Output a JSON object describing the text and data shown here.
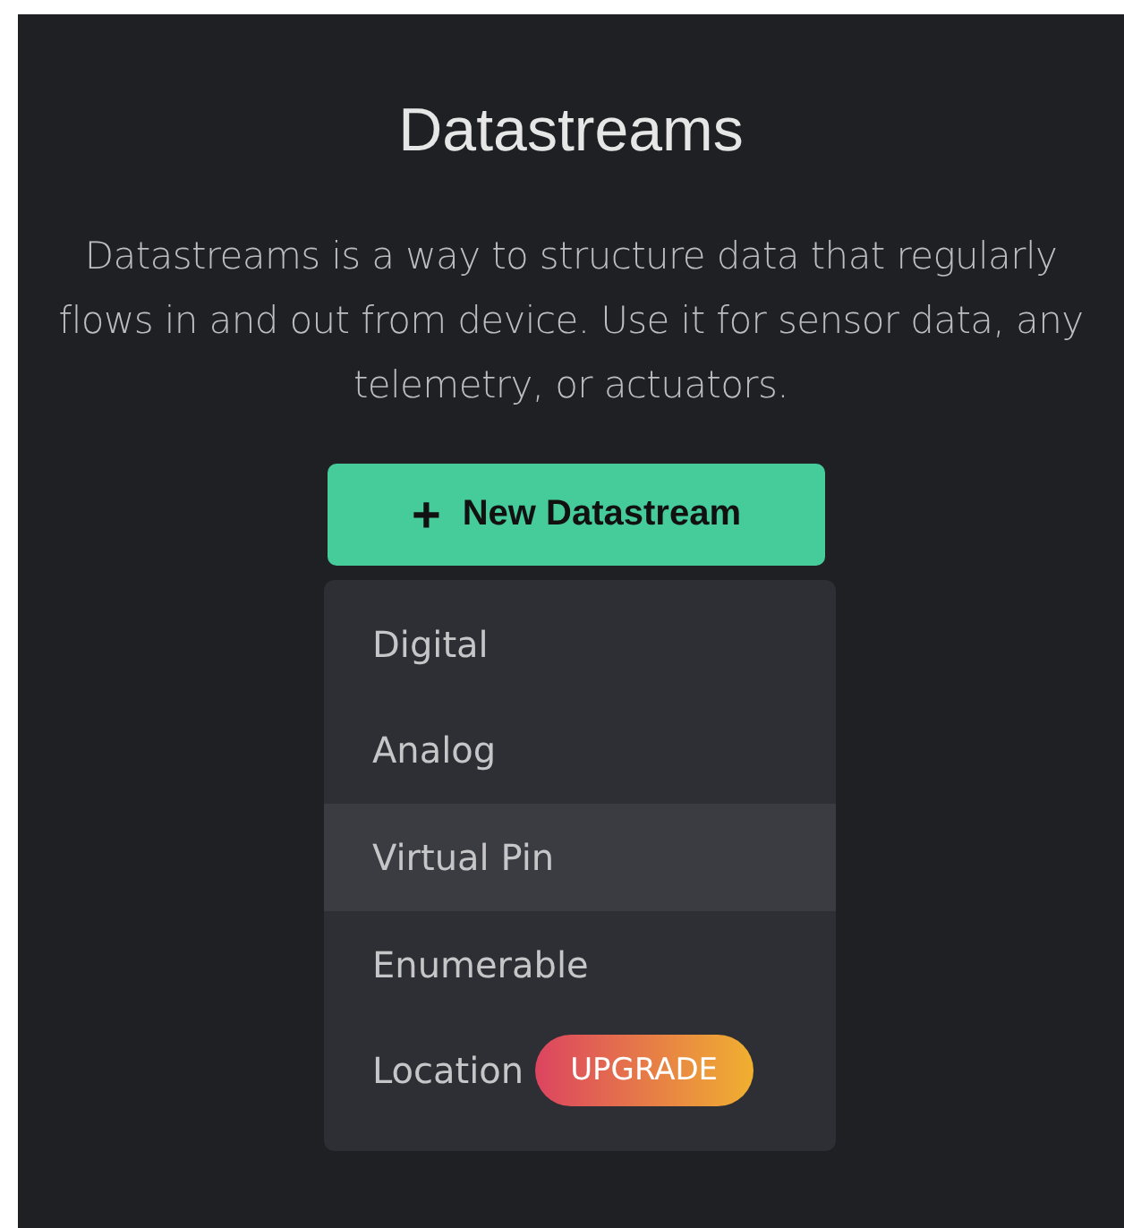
{
  "title": "Datastreams",
  "description": "Datastreams is a way to structure data that regularly flows in and out from device. Use it for sensor data, any telemetry, or actuators.",
  "button": {
    "icon": "+",
    "label": "New Datastream"
  },
  "menu": [
    {
      "label": "Digital",
      "selected": false
    },
    {
      "label": "Analog",
      "selected": false
    },
    {
      "label": "Virtual Pin",
      "selected": true
    },
    {
      "label": "Enumerable",
      "selected": false
    },
    {
      "label": "Location",
      "selected": false,
      "badge": "UPGRADE"
    }
  ]
}
